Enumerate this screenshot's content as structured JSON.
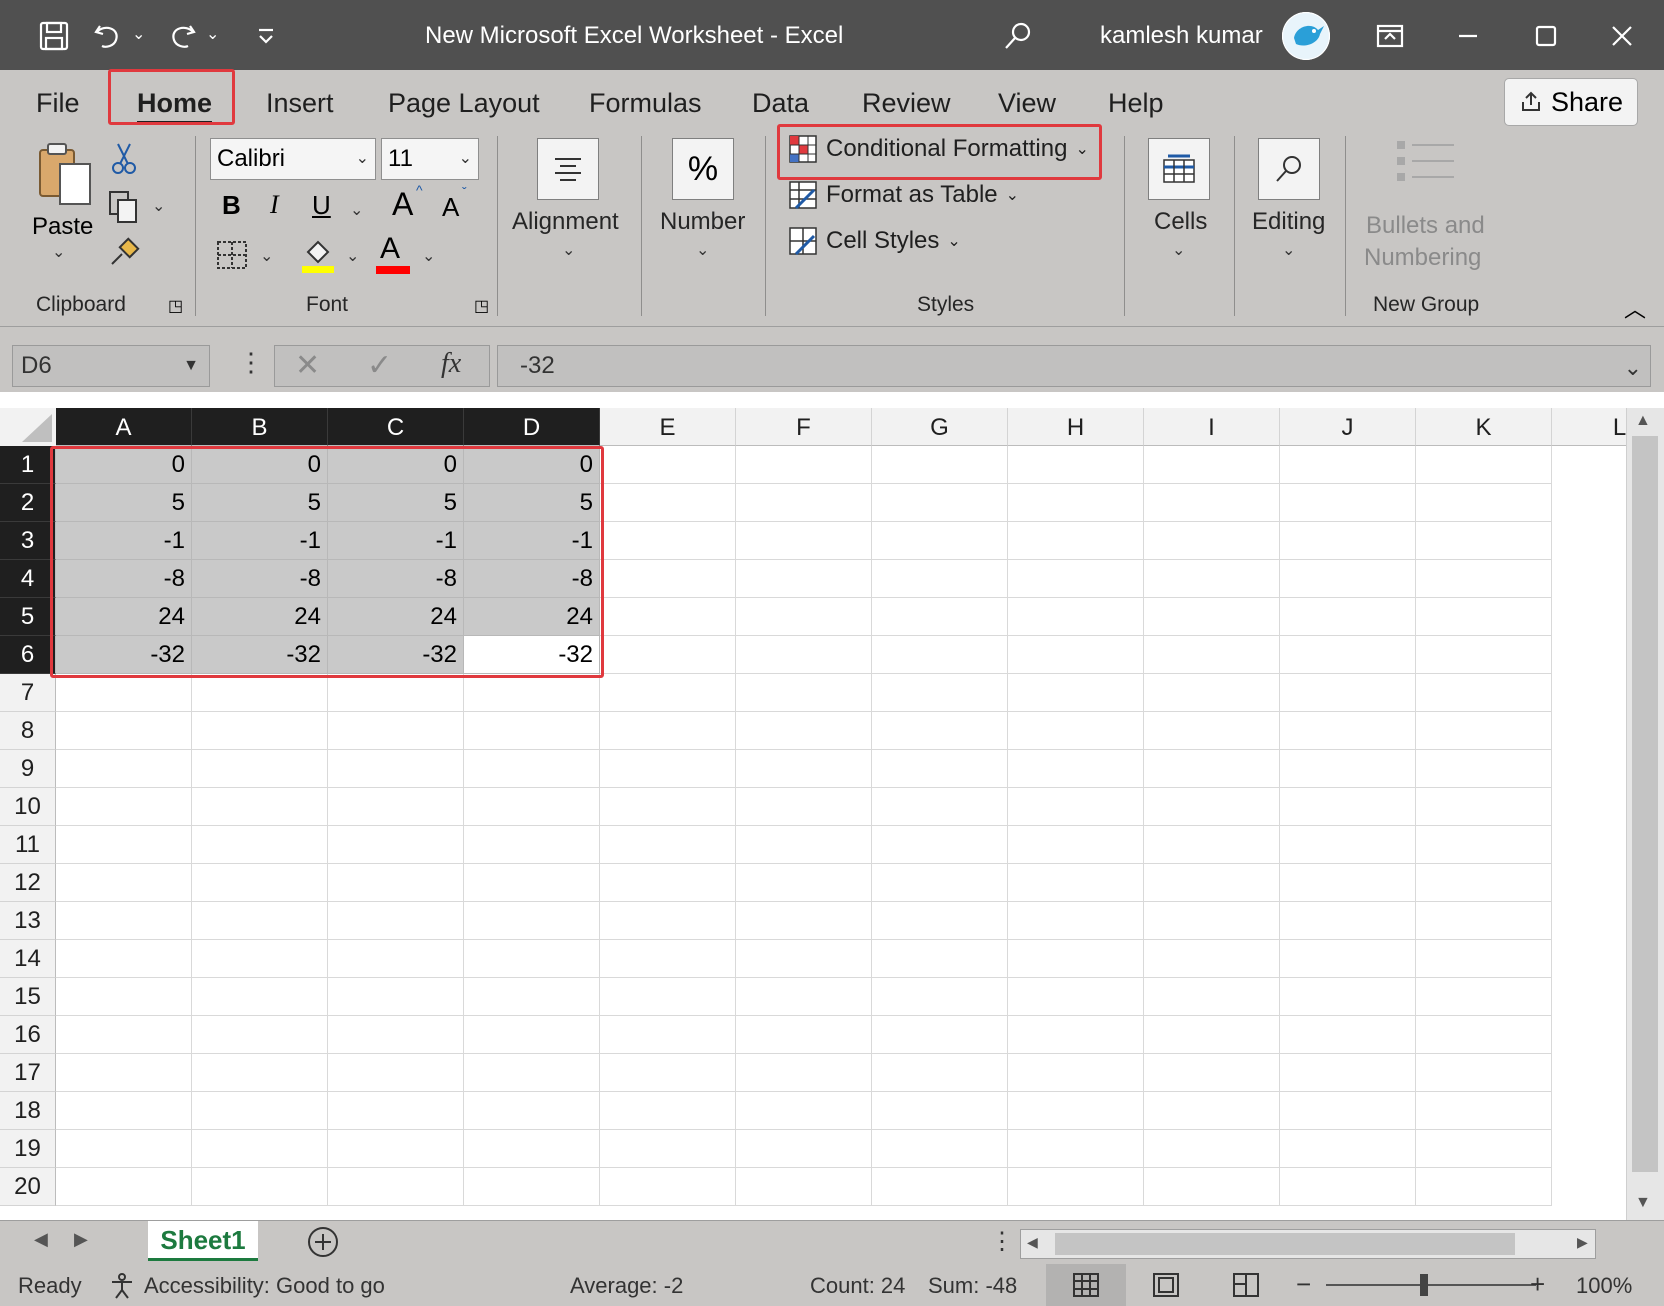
{
  "window": {
    "title": "New Microsoft Excel Worksheet  -  Excel",
    "user_name": "kamlesh kumar"
  },
  "ribbon": {
    "tabs": [
      "File",
      "Home",
      "Insert",
      "Page Layout",
      "Formulas",
      "Data",
      "Review",
      "View",
      "Help"
    ],
    "active_tab": "Home",
    "share_label": "Share",
    "clipboard": {
      "paste_label": "Paste",
      "group_label": "Clipboard"
    },
    "font": {
      "family": "Calibri",
      "size": "11",
      "bold": "B",
      "italic": "I",
      "underline": "U",
      "grow": "A",
      "shrink": "A",
      "font_color": "A",
      "group_label": "Font",
      "highlight_color": "#ffff00",
      "font_color_value": "#ff0000"
    },
    "alignment_label": "Alignment",
    "number_label": "Number",
    "number_symbol": "%",
    "styles": {
      "conditional_formatting": "Conditional Formatting",
      "format_as_table": "Format as Table",
      "cell_styles": "Cell Styles",
      "group_label": "Styles"
    },
    "cells_label": "Cells",
    "editing_label": "Editing",
    "new_group": {
      "bullets_line1": "Bullets and",
      "bullets_line2": "Numbering",
      "group_label": "New Group"
    },
    "highlight_color": "#e0393e"
  },
  "formula_bar": {
    "name_box": "D6",
    "fx": "fx",
    "value": "-32"
  },
  "grid": {
    "columns": [
      "A",
      "B",
      "C",
      "D",
      "E",
      "F",
      "G",
      "H",
      "I",
      "J",
      "K",
      "L"
    ],
    "selected_columns": [
      "A",
      "B",
      "C",
      "D"
    ],
    "rows": [
      "1",
      "2",
      "3",
      "4",
      "5",
      "6",
      "7",
      "8",
      "9",
      "10",
      "11",
      "12",
      "13",
      "14",
      "15",
      "16",
      "17",
      "18",
      "19",
      "20"
    ],
    "selected_rows": [
      "1",
      "2",
      "3",
      "4",
      "5",
      "6"
    ],
    "data": [
      [
        "0",
        "0",
        "0",
        "0"
      ],
      [
        "5",
        "5",
        "5",
        "5"
      ],
      [
        "-1",
        "-1",
        "-1",
        "-1"
      ],
      [
        "-8",
        "-8",
        "-8",
        "-8"
      ],
      [
        "24",
        "24",
        "24",
        "24"
      ],
      [
        "-32",
        "-32",
        "-32",
        "-32"
      ]
    ],
    "active_cell": "D6"
  },
  "sheets": {
    "tabs": [
      "Sheet1"
    ],
    "active": "Sheet1"
  },
  "status": {
    "ready": "Ready",
    "accessibility": "Accessibility: Good to go",
    "average": "Average: -2",
    "count": "Count: 24",
    "sum": "Sum: -48",
    "zoom": "100%",
    "zoom_minus": "−",
    "zoom_plus": "+"
  }
}
